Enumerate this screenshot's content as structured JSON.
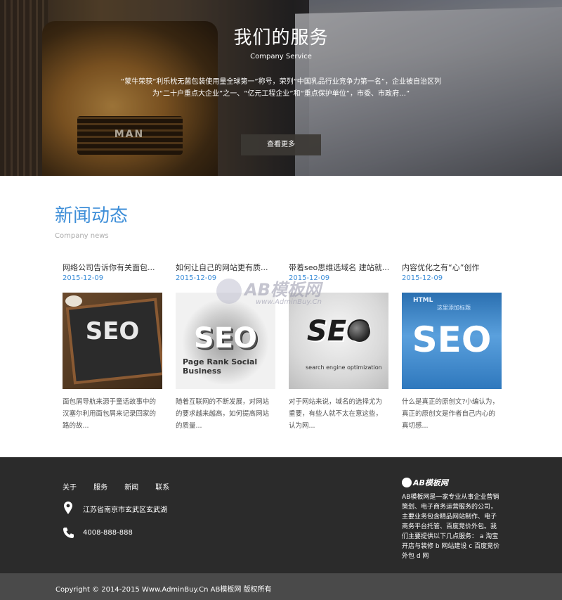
{
  "hero": {
    "title": "我们的服务",
    "subtitle": "Company Service",
    "description": "“蒙牛荣获“利乐枕无菌包装使用量全球第一”称号，荣列“中国乳品行业竞争力第一名”，企业被自治区列为“二十户重点大企业”之一、“亿元工程企业”和“重点保护单位”，市委、市政府…”",
    "button_label": "查看更多",
    "truck_badge": "MAN"
  },
  "news": {
    "title": "新闻动态",
    "subtitle": "Company news",
    "items": [
      {
        "title": "网络公司告诉你有关面包...",
        "date": "2015-12-09",
        "image_icon": "seo-chalkboard-image",
        "image_text": "SEO",
        "description": "面包屑导航来源于童话故事中的汉塞尔利用面包屑来记录回家的路的故..."
      },
      {
        "title": "如何让自己的网站更有质...",
        "date": "2015-12-09",
        "image_icon": "seo-wordcloud-image",
        "image_text": "SEO",
        "image_words": "Page Rank Social Business",
        "description": "随着互联网的不断发展，对网站的要求越来越高，如何提高网站的质量..."
      },
      {
        "title": "带着seo思维选域名 建站就...",
        "date": "2015-12-09",
        "image_icon": "seo-3d-text-image",
        "image_text": "SEO",
        "image_words": "search engine optimization",
        "description": "对于网站来说，域名的选择尤为重要，有些人就不太在意这些，认为网..."
      },
      {
        "title": "内容优化之有“心”创作",
        "date": "2015-12-09",
        "image_icon": "seo-blue-image",
        "image_text": "SEO",
        "image_words": "HTML",
        "image_words2": "这里添加标题",
        "description": "什么是真正的原创文?小编认为，真正的原创文是作者自己内心的真切感..."
      }
    ]
  },
  "watermark": {
    "text": "AB模板网",
    "sub": "www.AdminBuy.Cn"
  },
  "footer": {
    "nav": [
      "关于",
      "服务",
      "新闻",
      "联系"
    ],
    "address": "江苏省南京市玄武区玄武湖",
    "phone": "4008-888-888",
    "logo_text": "AB模板网",
    "description": "AB模板网是一家专业从事企业营销策划、电子商务运营服务的公司，主要业务包含精品网站制作、电子商务平台托管、百度竞价外包。我们主要提供以下几点服务： a 淘宝开店与装修 b 网站建设 c 百度竞价外包 d 网",
    "copyright": "Copyright © 2014-2015 Www.AdminBuy.Cn AB模板网 版权所有"
  },
  "colors": {
    "accent": "#3d8ed8",
    "footer_bg": "#2b2b2b",
    "copyright_bg": "#4a4a4a"
  }
}
